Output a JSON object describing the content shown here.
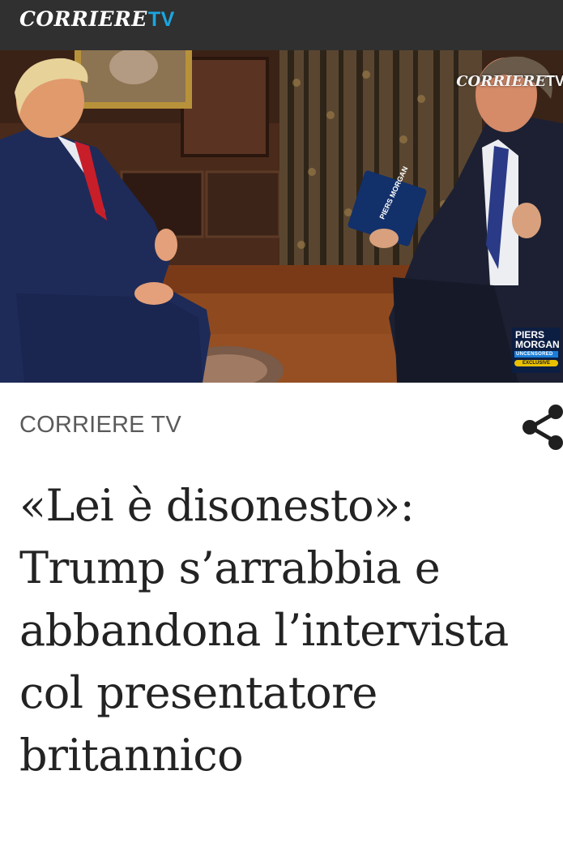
{
  "header": {
    "logo_main": "CORRIERE",
    "logo_tv": "TV"
  },
  "video": {
    "watermark_main": "CORRIERE",
    "watermark_tv": "TV",
    "badge_line1": "PIERS",
    "badge_line2": "MORGAN",
    "badge_line3": "UNCENSORED",
    "badge_line4": "EXCLUSIVE"
  },
  "article": {
    "section": "CORRIERE TV",
    "title": "«Lei è disonesto»: Trump s’arrabbia e abbandona l’intervista col presentatore britannico"
  },
  "icons": {
    "share": "share-icon"
  },
  "colors": {
    "topbar": "#303030",
    "logo_accent": "#1aa6e0",
    "headline": "#232323",
    "section_label": "#5a5a5a"
  }
}
